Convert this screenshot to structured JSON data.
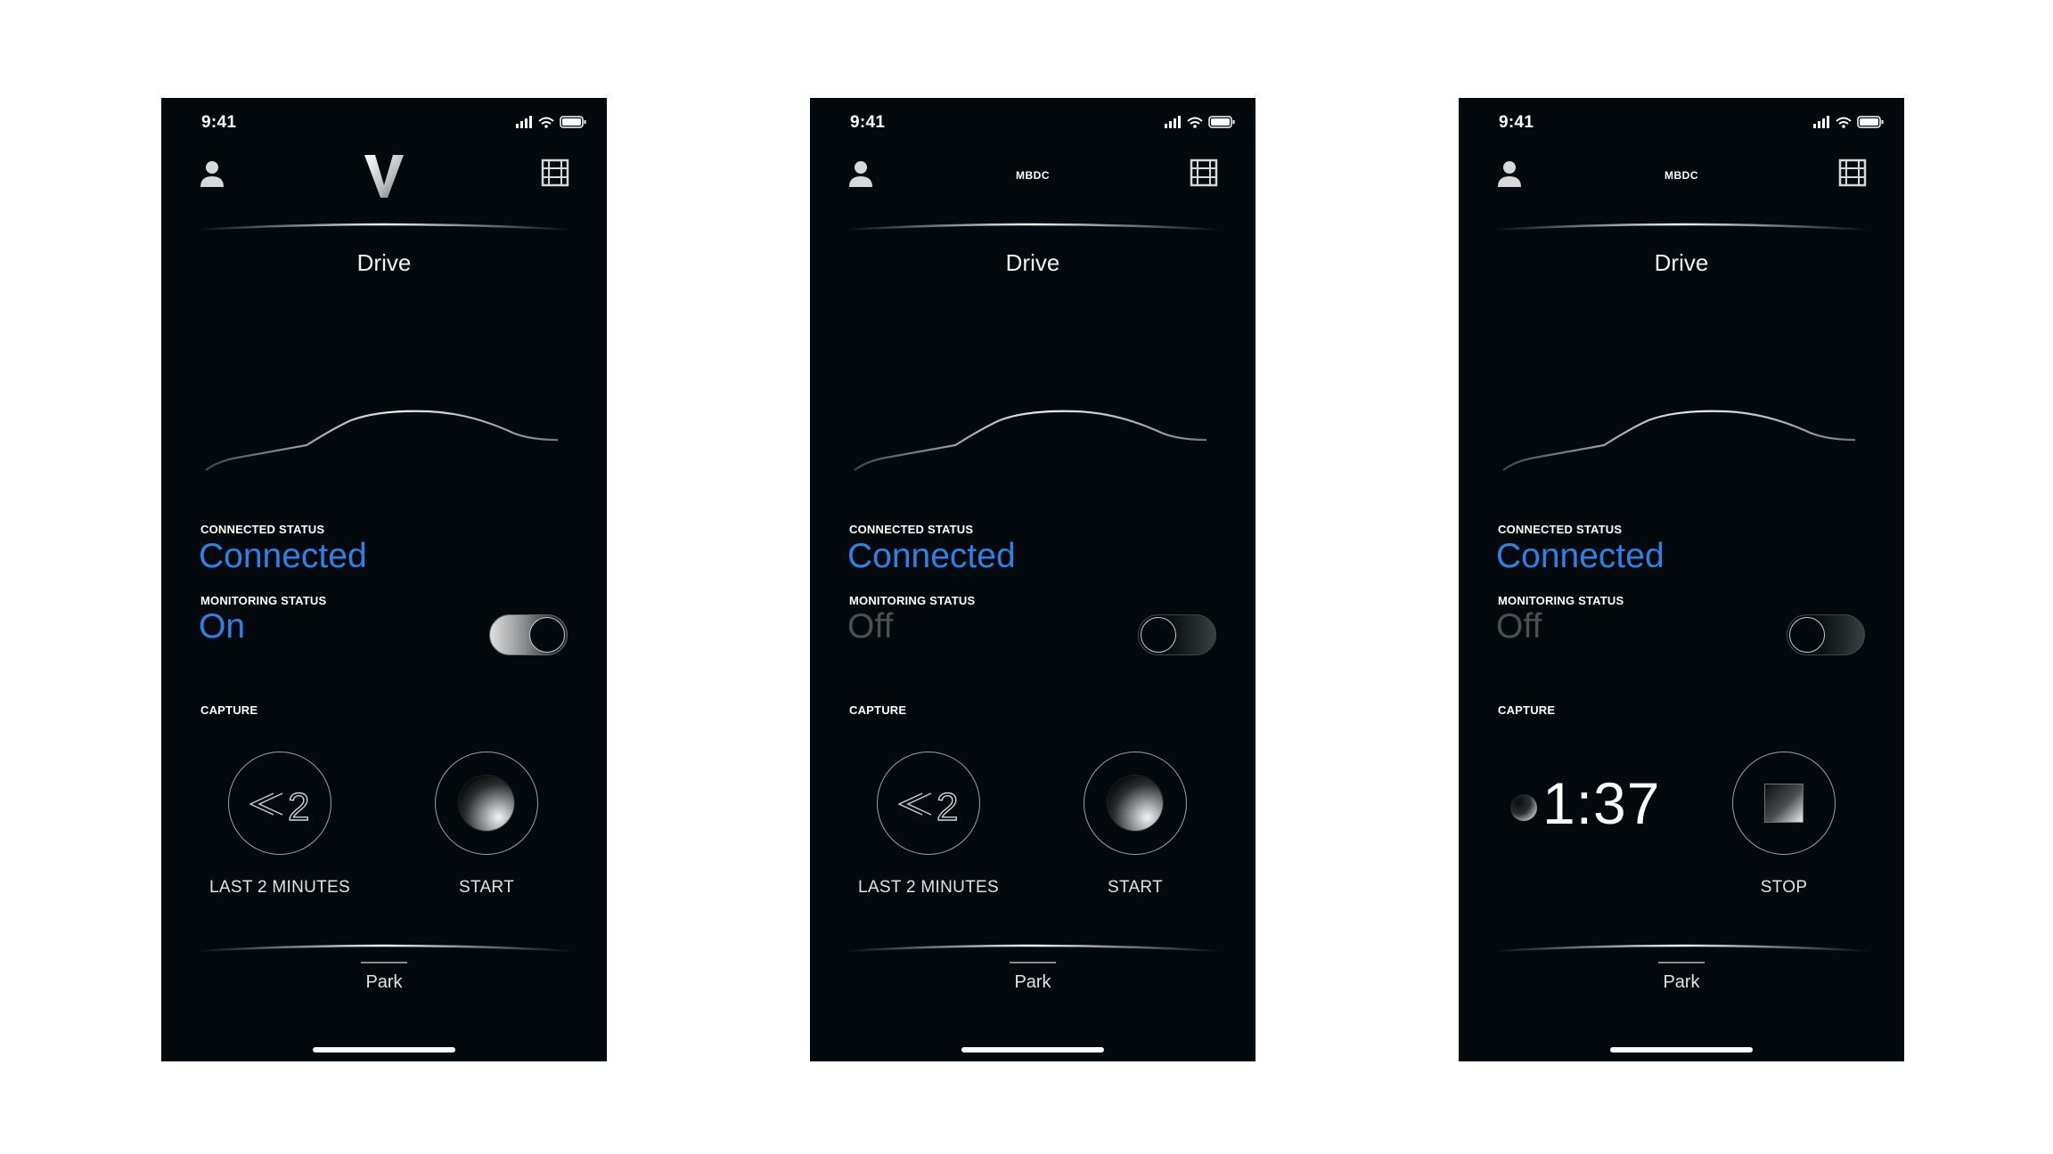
{
  "screens": [
    {
      "status": {
        "time": "9:41"
      },
      "header": {
        "brand_text": null,
        "has_logo": true
      },
      "title": "Drive",
      "connected": {
        "label": "CONNECTED STATUS",
        "value": "Connected"
      },
      "monitoring": {
        "label": "MONITORING STATUS",
        "value": "On",
        "toggle": "on"
      },
      "capture": {
        "label": "CAPTURE",
        "left_button": {
          "label": "LAST 2 MINUTES",
          "glyph_text": "2"
        },
        "right_button": {
          "label": "START"
        }
      },
      "bottom": {
        "label": "Park"
      }
    },
    {
      "status": {
        "time": "9:41"
      },
      "header": {
        "brand_text": "MBDC"
      },
      "title": "Drive",
      "connected": {
        "label": "CONNECTED STATUS",
        "value": "Connected"
      },
      "monitoring": {
        "label": "MONITORING STATUS",
        "value": "Off",
        "toggle": "off"
      },
      "capture": {
        "label": "CAPTURE",
        "left_button": {
          "label": "LAST 2 MINUTES",
          "glyph_text": "2"
        },
        "right_button": {
          "label": "START"
        }
      },
      "bottom": {
        "label": "Park"
      }
    },
    {
      "status": {
        "time": "9:41"
      },
      "header": {
        "brand_text": "MBDC"
      },
      "title": "Drive",
      "connected": {
        "label": "CONNECTED STATUS",
        "value": "Connected"
      },
      "monitoring": {
        "label": "MONITORING STATUS",
        "value": "Off",
        "toggle": "off"
      },
      "capture": {
        "label": "CAPTURE",
        "timer": "1:37",
        "right_button": {
          "label": "STOP"
        }
      },
      "bottom": {
        "label": "Park"
      }
    }
  ],
  "icons": {
    "profile": "person-icon",
    "menu": "film-grid-icon",
    "rewind": "rewind-icon",
    "record": "record-orb-icon",
    "stop": "stop-icon"
  },
  "colors": {
    "accent": "#2e82e6",
    "background": "#03090c",
    "inactive": "#4c4e50"
  }
}
